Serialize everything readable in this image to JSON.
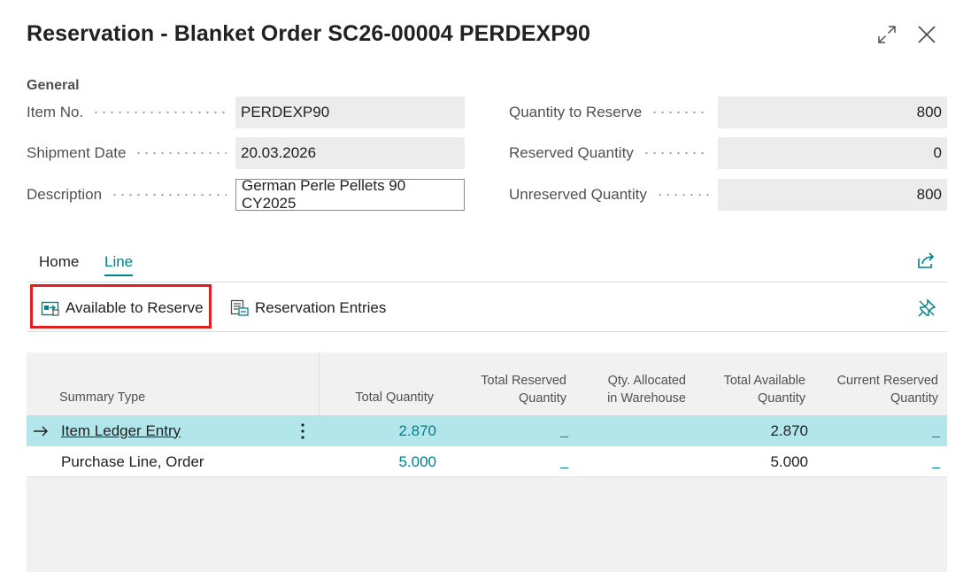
{
  "title": "Reservation - Blanket Order SC26-00004 PERDEXP90",
  "window": {
    "expand_icon": "expand-icon",
    "close_icon": "close-icon"
  },
  "general": {
    "heading": "General",
    "item_no_label": "Item No.",
    "item_no_value": "PERDEXP90",
    "shipment_date_label": "Shipment Date",
    "shipment_date_value": "20.03.2026",
    "description_label": "Description",
    "description_value": "German Perle Pellets 90 CY2025",
    "qty_to_reserve_label": "Quantity to Reserve",
    "qty_to_reserve_value": "800",
    "reserved_qty_label": "Reserved Quantity",
    "reserved_qty_value": "0",
    "unreserved_qty_label": "Unreserved Quantity",
    "unreserved_qty_value": "800"
  },
  "tabs": {
    "home": "Home",
    "line": "Line",
    "active": "Line"
  },
  "actions": {
    "available_to_reserve": "Available to Reserve",
    "reservation_entries": "Reservation Entries"
  },
  "table": {
    "headers": {
      "summary_type": "Summary Type",
      "total_quantity": "Total Quantity",
      "total_reserved_1": "Total Reserved",
      "total_reserved_2": "Quantity",
      "qty_allocated_1": "Qty. Allocated",
      "qty_allocated_2": "in Warehouse",
      "total_available_1": "Total Available",
      "total_available_2": "Quantity",
      "current_reserved_1": "Current Reserved",
      "current_reserved_2": "Quantity"
    },
    "rows": [
      {
        "summary_type": "Item Ledger Entry",
        "total_quantity": "2.870",
        "total_reserved_quantity": "_",
        "qty_allocated_in_warehouse": "",
        "total_available_quantity": "2.870",
        "current_reserved_quantity": "_",
        "selected": true
      },
      {
        "summary_type": "Purchase Line, Order",
        "total_quantity": "5.000",
        "total_reserved_quantity": "_",
        "qty_allocated_in_warehouse": "",
        "total_available_quantity": "5.000",
        "current_reserved_quantity": "_",
        "selected": false
      }
    ]
  },
  "colors": {
    "accent": "#00828a",
    "selected_row": "#b3e6ea",
    "highlight": "#e02020",
    "field_bg": "#ececec"
  }
}
